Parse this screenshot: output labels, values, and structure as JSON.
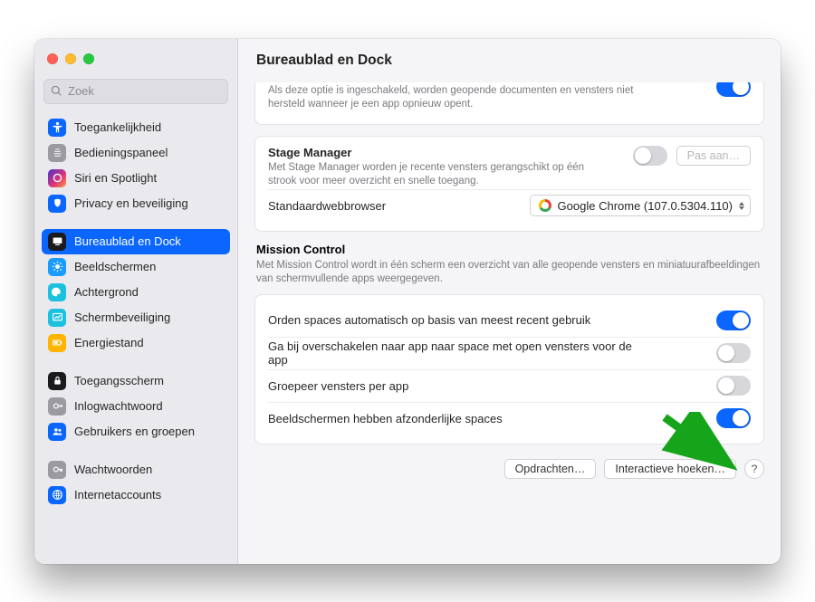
{
  "header": {
    "title": "Bureaublad en Dock"
  },
  "search": {
    "placeholder": "Zoek"
  },
  "sidebar": {
    "items": [
      {
        "label": "Toegankelijkheid",
        "icon": "accessibility",
        "cls": "ic-accessibility"
      },
      {
        "label": "Bedieningspaneel",
        "icon": "control",
        "cls": "ic-control"
      },
      {
        "label": "Siri en Spotlight",
        "icon": "siri",
        "cls": "ic-siri"
      },
      {
        "label": "Privacy en beveiliging",
        "icon": "privacy",
        "cls": "ic-privacy"
      },
      {
        "label": "Bureaublad en Dock",
        "icon": "desktop",
        "cls": "ic-desktop",
        "selected": true
      },
      {
        "label": "Beeldschermen",
        "icon": "displays",
        "cls": "ic-displays"
      },
      {
        "label": "Achtergrond",
        "icon": "wallpaper",
        "cls": "ic-wallpaper"
      },
      {
        "label": "Schermbeveiliging",
        "icon": "saver",
        "cls": "ic-saver"
      },
      {
        "label": "Energiestand",
        "icon": "energy",
        "cls": "ic-energy"
      },
      {
        "label": "Toegangsscherm",
        "icon": "lock",
        "cls": "ic-lock"
      },
      {
        "label": "Inlogwachtwoord",
        "icon": "login",
        "cls": "ic-login"
      },
      {
        "label": "Gebruikers en groepen",
        "icon": "users",
        "cls": "ic-users"
      },
      {
        "label": "Wachtwoorden",
        "icon": "passwords",
        "cls": "ic-passwords"
      },
      {
        "label": "Internetaccounts",
        "icon": "internet",
        "cls": "ic-internet"
      }
    ],
    "breaks": [
      4,
      9,
      12
    ]
  },
  "quitRestore": {
    "sub": "Als deze optie is ingeschakeld, worden geopende documenten en vensters niet hersteld wanneer je een app opnieuw opent.",
    "on": true
  },
  "stageManager": {
    "title": "Stage Manager",
    "sub": "Met Stage Manager worden je recente vensters gerangschikt op één strook voor meer overzicht en snelle toegang.",
    "on": false,
    "customize": "Pas aan…"
  },
  "browser": {
    "label": "Standaardwebbrowser",
    "value": "Google Chrome (107.0.5304.110)"
  },
  "missionControl": {
    "title": "Mission Control",
    "sub": "Met Mission Control wordt in één scherm een overzicht van alle geopende vensters en miniatuurafbeeldingen van schermvullende apps weergegeven.",
    "rows": [
      {
        "label": "Orden spaces automatisch op basis van meest recent gebruik",
        "on": true
      },
      {
        "label": "Ga bij overschakelen naar app naar space met open vensters voor de app",
        "on": false
      },
      {
        "label": "Groepeer vensters per app",
        "on": false
      },
      {
        "label": "Beeldschermen hebben afzonderlijke spaces",
        "on": true
      }
    ]
  },
  "footer": {
    "shortcuts": "Opdrachten…",
    "hotcorners": "Interactieve hoeken…",
    "help": "?"
  },
  "colors": {
    "accent": "#0a66ff",
    "arrow": "#16a51a"
  }
}
